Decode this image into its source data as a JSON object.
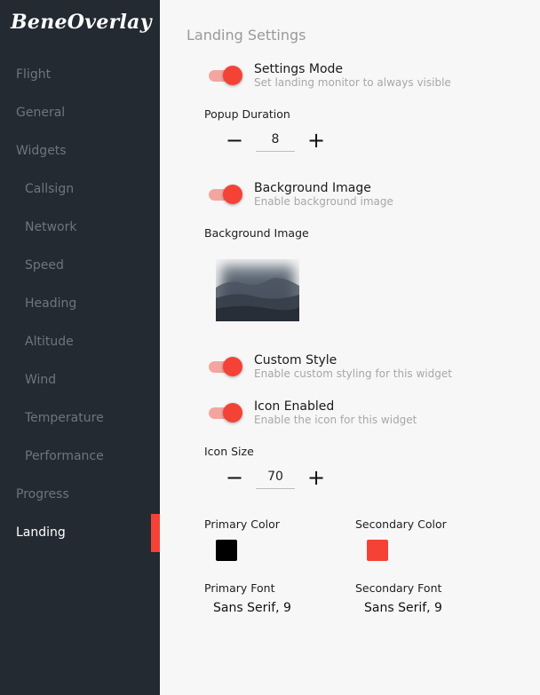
{
  "app": {
    "logo": "BeneOverlay"
  },
  "sidebar": {
    "items": [
      {
        "label": "Flight"
      },
      {
        "label": "General"
      },
      {
        "label": "Widgets"
      },
      {
        "label": "Callsign"
      },
      {
        "label": "Network"
      },
      {
        "label": "Speed"
      },
      {
        "label": "Heading"
      },
      {
        "label": "Altitude"
      },
      {
        "label": "Wind"
      },
      {
        "label": "Temperature"
      },
      {
        "label": "Performance"
      },
      {
        "label": "Progress"
      },
      {
        "label": "Landing"
      }
    ],
    "active_item": "Landing"
  },
  "main": {
    "title": "Landing Settings",
    "settings_mode": {
      "title": "Settings Mode",
      "description": "Set landing monitor to always visible",
      "enabled": true
    },
    "popup_duration": {
      "label": "Popup Duration",
      "value": "8",
      "minus": "−",
      "plus": "+"
    },
    "background_image_toggle": {
      "title": "Background Image",
      "description": "Enable background image",
      "enabled": true
    },
    "background_image": {
      "label": "Background Image"
    },
    "custom_style": {
      "title": "Custom Style",
      "description": "Enable custom styling for this widget",
      "enabled": true
    },
    "icon_enabled": {
      "title": "Icon Enabled",
      "description": "Enable the icon for this widget",
      "enabled": true
    },
    "icon_size": {
      "label": "Icon Size",
      "value": "70",
      "minus": "−",
      "plus": "+"
    },
    "primary_color": {
      "label": "Primary Color",
      "color": "#000000"
    },
    "secondary_color": {
      "label": "Secondary Color",
      "color": "#f44336"
    },
    "primary_font": {
      "label": "Primary Font",
      "value": "Sans Serif, 9"
    },
    "secondary_font": {
      "label": "Secondary Font",
      "value": "Sans Serif, 9"
    }
  },
  "colors": {
    "sidebar_bg": "#232a31",
    "accent": "#f44336",
    "content_bg": "#f7f7f7"
  }
}
